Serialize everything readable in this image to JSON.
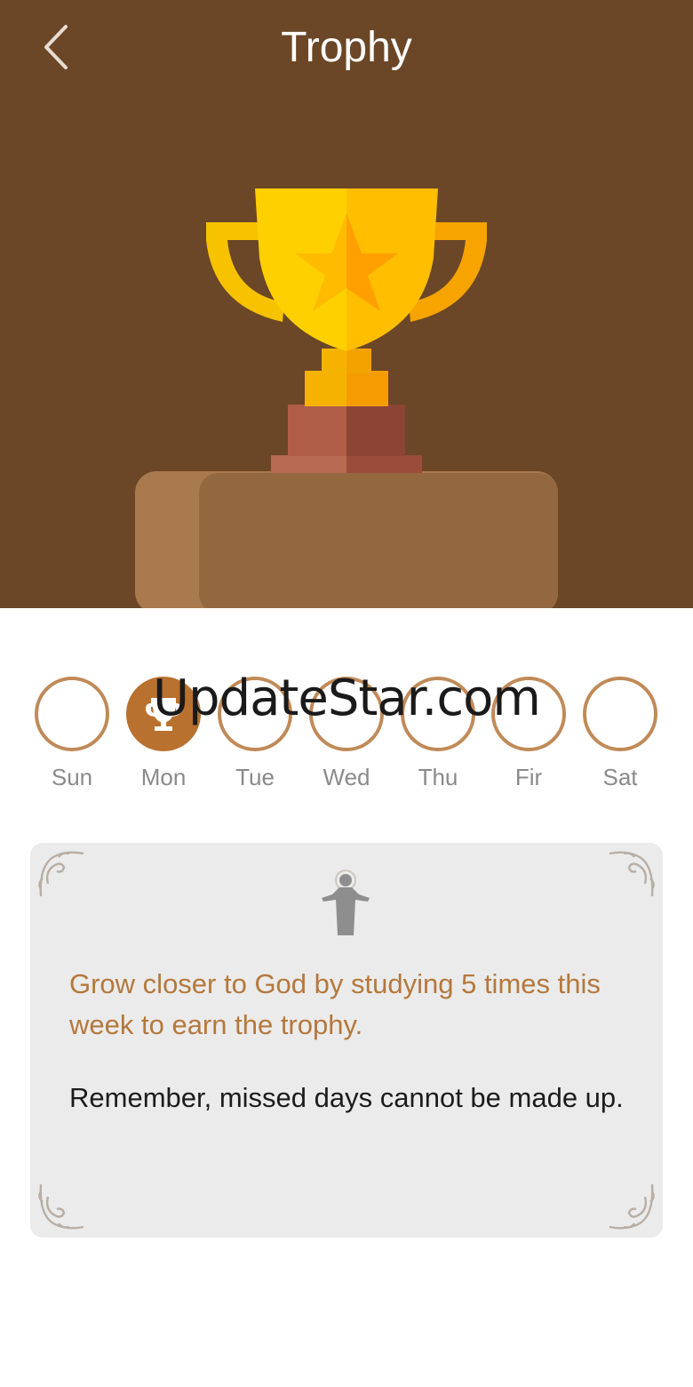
{
  "header": {
    "title": "Trophy",
    "back_icon": "chevron-left-icon"
  },
  "hero": {
    "background_color": "#6b4727",
    "illustration": "gold-trophy-on-pedestal",
    "icon": "trophy-star-icon"
  },
  "watermark": {
    "text": "UpdateStar.com"
  },
  "week": {
    "days": [
      {
        "label": "Sun",
        "earned": false
      },
      {
        "label": "Mon",
        "earned": true,
        "icon": "trophy-icon"
      },
      {
        "label": "Tue",
        "earned": false
      },
      {
        "label": "Wed",
        "earned": false
      },
      {
        "label": "Thu",
        "earned": false
      },
      {
        "label": "Fir",
        "earned": false
      },
      {
        "label": "Sat",
        "earned": false
      }
    ],
    "accent_color": "#b9712f",
    "ring_color": "#c08a58"
  },
  "card": {
    "icon": "jesus-figure-icon",
    "goal": "Grow closer to God by studying 5 times this week to earn the trophy.",
    "note": "Remember, missed days cannot be made up.",
    "goal_color": "#b5783c",
    "background_color": "#ebebeb"
  }
}
